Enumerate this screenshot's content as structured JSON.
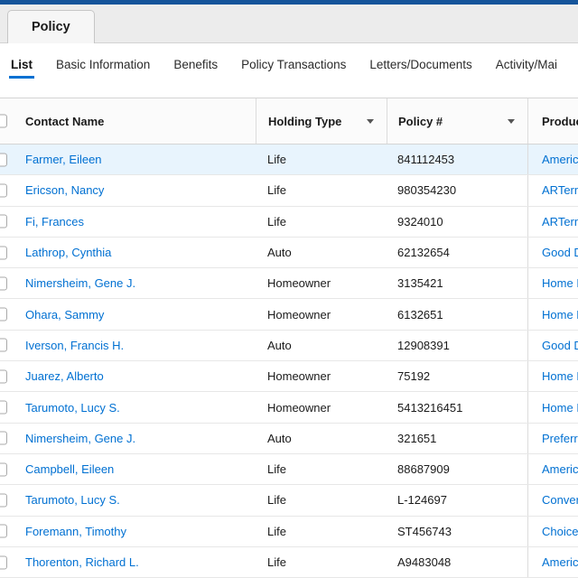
{
  "colors": {
    "top_bar": "#15549a",
    "link": "#0070d2",
    "active_underline": "#0070d2",
    "selected_row_bg": "#e8f4fd"
  },
  "icons": {
    "holding_type_filter": "chevron-down-icon",
    "policy_number_filter": "chevron-down-icon"
  },
  "tab": {
    "label": "Policy"
  },
  "subnav": {
    "items": [
      {
        "label": "List",
        "active": true
      },
      {
        "label": "Basic Information",
        "active": false
      },
      {
        "label": "Benefits",
        "active": false
      },
      {
        "label": "Policy Transactions",
        "active": false
      },
      {
        "label": "Letters/Documents",
        "active": false
      },
      {
        "label": "Activity/Mai",
        "active": false
      }
    ]
  },
  "table": {
    "columns": {
      "contact": "Contact Name",
      "holding": "Holding Type",
      "policy": "Policy #",
      "product": "Produc"
    },
    "rows": [
      {
        "contact": "Farmer, Eileen",
        "holding": "Life",
        "policy": "841112453",
        "product": "America",
        "selected": true
      },
      {
        "contact": "Ericson, Nancy",
        "holding": "Life",
        "policy": "980354230",
        "product": "ARTerm",
        "selected": false
      },
      {
        "contact": "Fi, Frances",
        "holding": "Life",
        "policy": "9324010",
        "product": "ARTerm",
        "selected": false
      },
      {
        "contact": "Lathrop, Cynthia",
        "holding": "Auto",
        "policy": "62132654",
        "product": "Good D",
        "selected": false
      },
      {
        "contact": "Nimersheim, Gene J.",
        "holding": "Homeowner",
        "policy": "3135421",
        "product": "Home I",
        "selected": false
      },
      {
        "contact": "Ohara, Sammy",
        "holding": "Homeowner",
        "policy": "6132651",
        "product": "Home P",
        "selected": false
      },
      {
        "contact": "Iverson, Francis H.",
        "holding": "Auto",
        "policy": "12908391",
        "product": "Good D",
        "selected": false
      },
      {
        "contact": "Juarez, Alberto",
        "holding": "Homeowner",
        "policy": "75192",
        "product": "Home I",
        "selected": false
      },
      {
        "contact": "Tarumoto, Lucy S.",
        "holding": "Homeowner",
        "policy": "5413216451",
        "product": "Home I",
        "selected": false
      },
      {
        "contact": "Nimersheim, Gene J.",
        "holding": "Auto",
        "policy": "321651",
        "product": "Preferr",
        "selected": false
      },
      {
        "contact": "Campbell, Eileen",
        "holding": "Life",
        "policy": "88687909",
        "product": "America",
        "selected": false
      },
      {
        "contact": "Tarumoto, Lucy S.",
        "holding": "Life",
        "policy": "L-124697",
        "product": "Conver",
        "selected": false
      },
      {
        "contact": "Foremann, Timothy",
        "holding": "Life",
        "policy": "ST456743",
        "product": "ChoiceL",
        "selected": false
      },
      {
        "contact": "Thorenton, Richard L.",
        "holding": "Life",
        "policy": "A9483048",
        "product": "America",
        "selected": false
      }
    ]
  }
}
